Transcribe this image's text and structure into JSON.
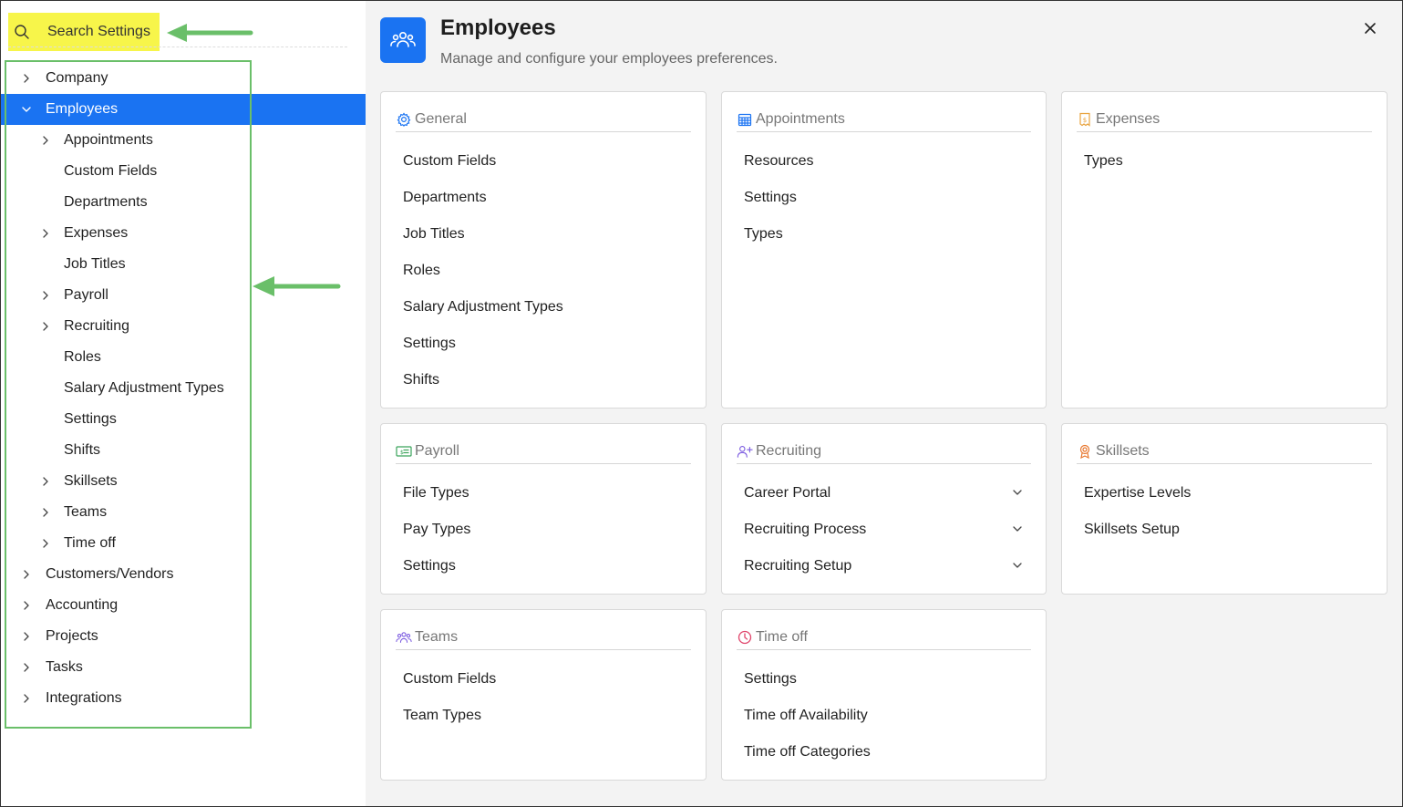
{
  "search": {
    "label": "Search Settings"
  },
  "sidebar": {
    "items": [
      {
        "label": "Company",
        "level": 0,
        "chevron": "right"
      },
      {
        "label": "Employees",
        "level": 0,
        "chevron": "down",
        "selected": true
      },
      {
        "label": "Appointments",
        "level": 1,
        "chevron": "right"
      },
      {
        "label": "Custom Fields",
        "level": 1,
        "chevron": ""
      },
      {
        "label": "Departments",
        "level": 1,
        "chevron": ""
      },
      {
        "label": "Expenses",
        "level": 1,
        "chevron": "right"
      },
      {
        "label": "Job Titles",
        "level": 1,
        "chevron": ""
      },
      {
        "label": "Payroll",
        "level": 1,
        "chevron": "right"
      },
      {
        "label": "Recruiting",
        "level": 1,
        "chevron": "right"
      },
      {
        "label": "Roles",
        "level": 1,
        "chevron": ""
      },
      {
        "label": "Salary Adjustment Types",
        "level": 1,
        "chevron": ""
      },
      {
        "label": "Settings",
        "level": 1,
        "chevron": ""
      },
      {
        "label": "Shifts",
        "level": 1,
        "chevron": ""
      },
      {
        "label": "Skillsets",
        "level": 1,
        "chevron": "right"
      },
      {
        "label": "Teams",
        "level": 1,
        "chevron": "right"
      },
      {
        "label": "Time off",
        "level": 1,
        "chevron": "right"
      },
      {
        "label": "Customers/Vendors",
        "level": 0,
        "chevron": "right"
      },
      {
        "label": "Accounting",
        "level": 0,
        "chevron": "right"
      },
      {
        "label": "Projects",
        "level": 0,
        "chevron": "right"
      },
      {
        "label": "Tasks",
        "level": 0,
        "chevron": "right"
      },
      {
        "label": "Integrations",
        "level": 0,
        "chevron": "right"
      }
    ]
  },
  "header": {
    "title": "Employees",
    "subtitle": "Manage and configure your employees preferences.",
    "icon": "people-icon"
  },
  "colors": {
    "accent": "#1a73f2",
    "highlight": "#f7f54a",
    "annotation": "#6abf69"
  },
  "cards": [
    {
      "title": "General",
      "icon": "gear-icon",
      "items": [
        {
          "label": "Custom Fields"
        },
        {
          "label": "Departments"
        },
        {
          "label": "Job Titles"
        },
        {
          "label": "Roles"
        },
        {
          "label": "Salary Adjustment Types"
        },
        {
          "label": "Settings"
        },
        {
          "label": "Shifts"
        }
      ]
    },
    {
      "title": "Appointments",
      "icon": "calendar-icon",
      "items": [
        {
          "label": "Resources"
        },
        {
          "label": "Settings"
        },
        {
          "label": "Types"
        }
      ]
    },
    {
      "title": "Expenses",
      "icon": "receipt-icon",
      "items": [
        {
          "label": "Types"
        }
      ]
    },
    {
      "title": "Payroll",
      "icon": "payroll-card-icon",
      "items": [
        {
          "label": "File Types"
        },
        {
          "label": "Pay Types"
        },
        {
          "label": "Settings"
        }
      ]
    },
    {
      "title": "Recruiting",
      "icon": "user-plus-icon",
      "items": [
        {
          "label": "Career Portal",
          "expandable": true
        },
        {
          "label": "Recruiting Process",
          "expandable": true
        },
        {
          "label": "Recruiting Setup",
          "expandable": true
        }
      ]
    },
    {
      "title": "Skillsets",
      "icon": "badge-icon",
      "items": [
        {
          "label": "Expertise Levels"
        },
        {
          "label": "Skillsets Setup"
        }
      ]
    },
    {
      "title": "Teams",
      "icon": "team-icon",
      "items": [
        {
          "label": "Custom Fields"
        },
        {
          "label": "Team Types"
        }
      ]
    },
    {
      "title": "Time off",
      "icon": "clock-icon",
      "items": [
        {
          "label": "Settings"
        },
        {
          "label": "Time off Availability"
        },
        {
          "label": "Time off Categories"
        }
      ]
    }
  ]
}
